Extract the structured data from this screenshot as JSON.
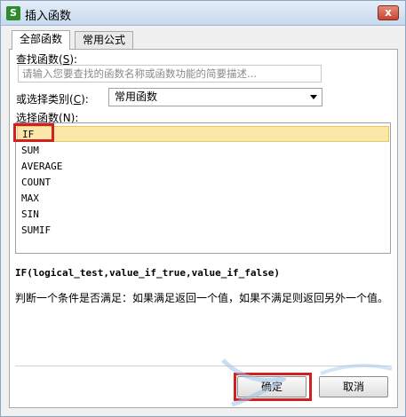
{
  "window": {
    "title": "插入函数",
    "app_icon_glyph": "S",
    "close_glyph": "x"
  },
  "tabs": [
    {
      "label": "全部函数",
      "active": true
    },
    {
      "label": "常用公式",
      "active": false
    }
  ],
  "search": {
    "label": "查找函数(",
    "label_key": "S",
    "label_end": "):",
    "placeholder": "请输入您要查找的函数名称或函数功能的简要描述..."
  },
  "category": {
    "label": "或选择类别(",
    "label_key": "C",
    "label_end": "):",
    "value": "常用函数"
  },
  "function_list": {
    "label": "选择函数(",
    "label_key": "N",
    "label_end": "):",
    "items": [
      "IF",
      "SUM",
      "AVERAGE",
      "COUNT",
      "MAX",
      "SIN",
      "SUMIF"
    ],
    "selected": "IF"
  },
  "details": {
    "syntax": "IF(logical_test,value_if_true,value_if_false)",
    "description": "判断一个条件是否满足：如果满足返回一个值，如果不满足则返回另外一个值。"
  },
  "buttons": {
    "ok": "确定",
    "cancel": "取消"
  },
  "colors": {
    "highlight_box": "#d21f1f",
    "selection_bg": "#fbe7a8",
    "app_icon": "#2e8b2e"
  }
}
